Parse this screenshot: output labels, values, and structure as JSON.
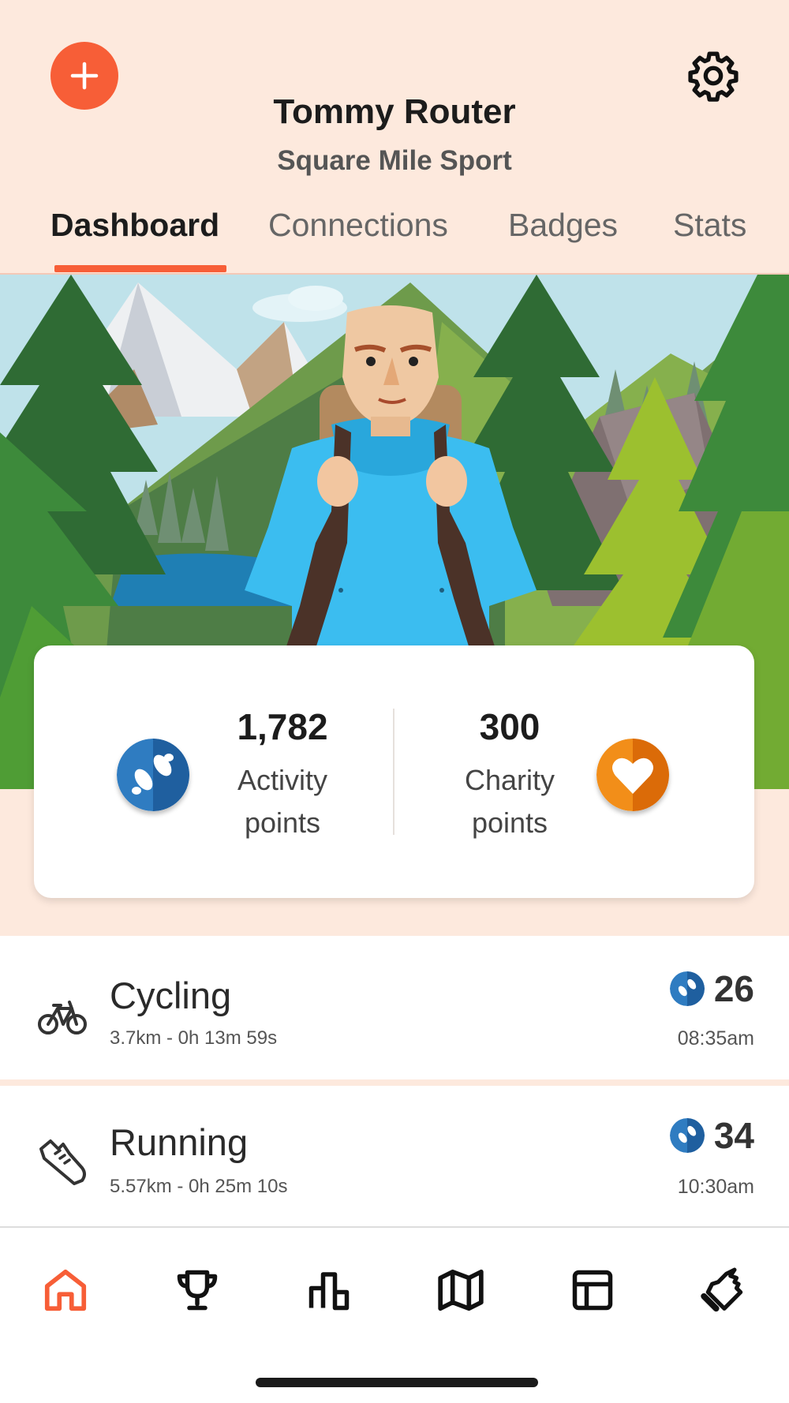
{
  "header": {
    "user_name": "Tommy Router",
    "club_name": "Square Mile Sport",
    "add_icon": "plus-icon",
    "settings_icon": "gear-icon"
  },
  "tabs": [
    {
      "label": "Dashboard",
      "active": true
    },
    {
      "label": "Connections",
      "active": false
    },
    {
      "label": "Badges",
      "active": false
    },
    {
      "label": "Stats",
      "active": false
    }
  ],
  "points": {
    "activity": {
      "value": "1,782",
      "label_line1": "Activity",
      "label_line2": "points",
      "icon": "footprints-icon"
    },
    "charity": {
      "value": "300",
      "label_line1": "Charity",
      "label_line2": "points",
      "icon": "heart-icon"
    }
  },
  "activities": [
    {
      "name": "Cycling",
      "detail": "3.7km - 0h 13m 59s",
      "points": "26",
      "time": "08:35am",
      "icon": "bicycle-icon"
    },
    {
      "name": "Running",
      "detail": "5.57km - 0h 25m 10s",
      "points": "34",
      "time": "10:30am",
      "icon": "running-shoe-icon"
    }
  ],
  "bottom_nav": [
    {
      "name": "home",
      "icon": "home-icon",
      "active": true
    },
    {
      "name": "trophy",
      "icon": "trophy-icon",
      "active": false
    },
    {
      "name": "leaderboard",
      "icon": "bar-chart-icon",
      "active": false
    },
    {
      "name": "map",
      "icon": "map-icon",
      "active": false
    },
    {
      "name": "layout",
      "icon": "layout-icon",
      "active": false
    },
    {
      "name": "like",
      "icon": "thumbs-up-icon",
      "active": false
    }
  ],
  "colors": {
    "accent": "#f75e37",
    "background": "#fde9dd",
    "activity_blue": "#2f7cc1",
    "charity_orange": "#f08a16"
  }
}
